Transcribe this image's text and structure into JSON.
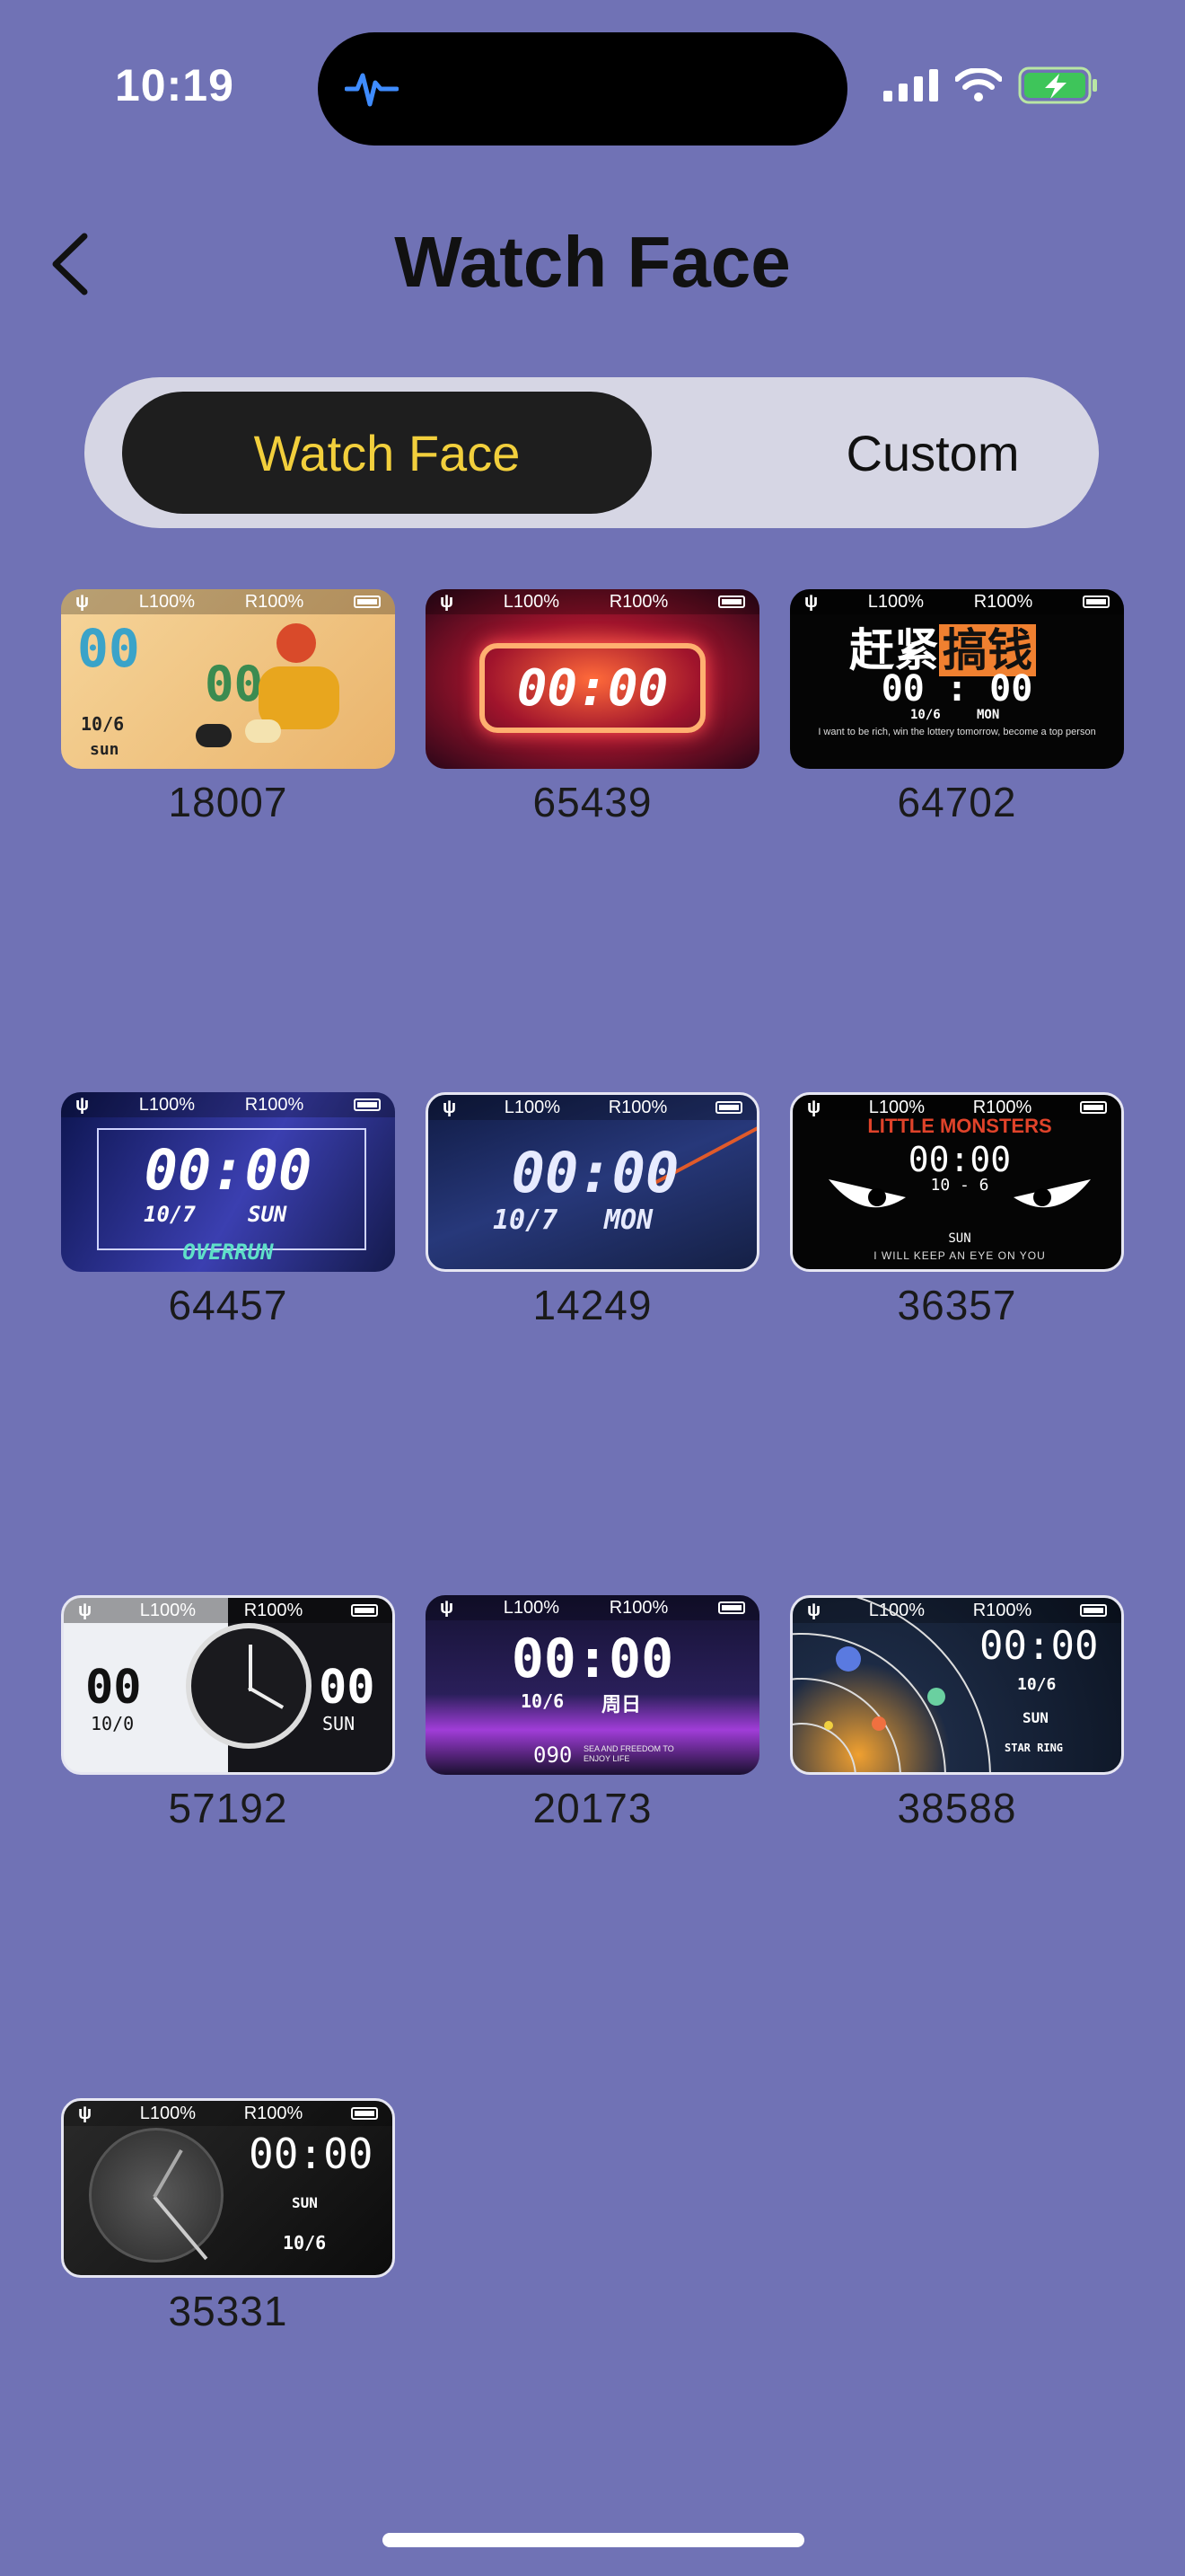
{
  "status_bar": {
    "time": "10:19"
  },
  "header": {
    "title": "Watch Face"
  },
  "tabs": [
    {
      "label": "Watch Face",
      "active": true
    },
    {
      "label": "Custom",
      "active": false
    }
  ],
  "thumb_status": {
    "left": "L100%",
    "right": "R100%"
  },
  "faces": [
    {
      "id": "18007",
      "time": "00 00",
      "date": "10/6",
      "day": "sun",
      "bg": "#f3c98a",
      "accent": "#3fa0c6"
    },
    {
      "id": "65439",
      "time": "00:00",
      "bg": "#3a0a1c",
      "accent": "#ff4a4a"
    },
    {
      "id": "64702",
      "time": "00 : 00",
      "date": "10/6",
      "day": "MON",
      "headline": "赶紧搞钱",
      "caption": "I want to be rich, win the lottery tomorrow, become a top person",
      "bg": "#0a0a0a",
      "accent": "#f08030"
    },
    {
      "id": "64457",
      "time": "00:00",
      "date": "10/7",
      "day": "SUN",
      "caption": "OVERRUN",
      "bg": "#1f2a6e",
      "accent": "#8a7bff"
    },
    {
      "id": "14249",
      "time": "00:00",
      "date": "10/7",
      "day": "MON",
      "bg": "#1b2550",
      "accent": "#4a6dd0"
    },
    {
      "id": "36357",
      "time": "00:00",
      "date": "10 - 6",
      "day": "SUN",
      "headline": "LITTLE MONSTERS",
      "caption": "I WILL KEEP AN EYE ON YOU",
      "bg": "#050505",
      "accent": "#e0432a"
    },
    {
      "id": "57192",
      "time": "00",
      "time2": "00",
      "date": "10/0",
      "day": "SUN",
      "bg": "#f0f0f0",
      "accent": "#1a1a1a"
    },
    {
      "id": "20173",
      "time": "00:00",
      "date": "10/6",
      "day": "周日",
      "steps": "090",
      "caption": "SEA AND FREEDOM TO ENJOY LIFE",
      "bg": "#1a1440",
      "accent": "#b04ae0"
    },
    {
      "id": "38588",
      "time": "00:00",
      "date": "10/6",
      "day": "SUN",
      "caption": "STAR RING",
      "bg": "#0e1a2a",
      "accent": "#f0a030"
    },
    {
      "id": "35331",
      "time": "00:00",
      "date": "10/6",
      "day": "SUN",
      "bg": "#151515",
      "accent": "#888888"
    }
  ]
}
